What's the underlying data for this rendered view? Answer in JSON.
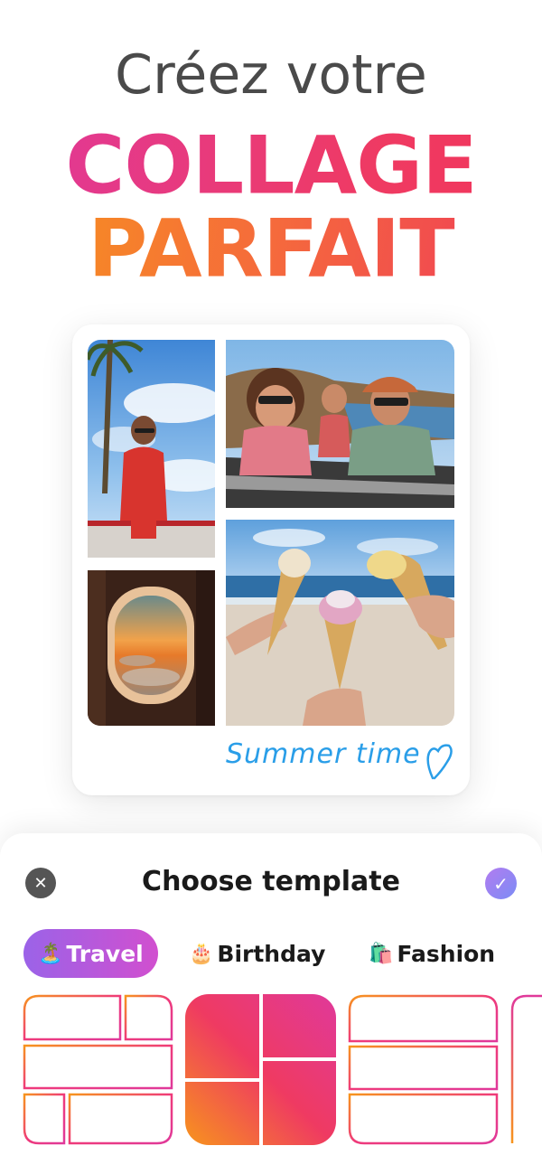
{
  "headline": {
    "subtitle": "Créez votre",
    "line1": "COLLAGE",
    "line2": "PARFAIT"
  },
  "collage": {
    "caption": "Summer time",
    "photos": [
      "woman-palm-tree-photo",
      "friends-in-convertible-photo",
      "airplane-window-sunset-photo",
      "ice-cream-beach-photo"
    ]
  },
  "sheet": {
    "title": "Choose template",
    "close_icon": "close-icon",
    "confirm_icon": "check-icon",
    "categories": [
      {
        "emoji": "🏝️",
        "label": "Travel",
        "selected": true
      },
      {
        "emoji": "🎂",
        "label": "Birthday",
        "selected": false
      },
      {
        "emoji": "🛍️",
        "label": "Fashion",
        "selected": false
      }
    ],
    "selected_template": 2
  },
  "colors": {
    "gradient_pink": "#e0399a",
    "gradient_red": "#ef3a5a",
    "gradient_orange": "#f7941d",
    "chip_purple": "#9b63e8",
    "caption_blue": "#2a9ee8"
  }
}
